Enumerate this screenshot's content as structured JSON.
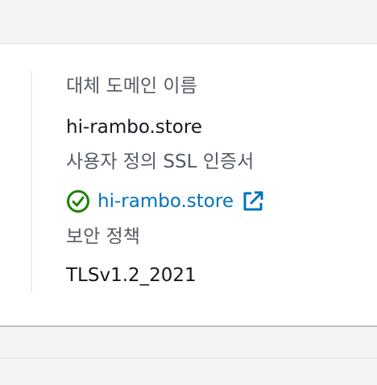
{
  "details": {
    "alt_domain_label": "대체 도메인 이름",
    "alt_domain_value": "hi-rambo.store",
    "ssl_label": "사용자 정의 SSL 인증서",
    "ssl_cert_link": "hi-rambo.store",
    "ssl_status_icon": "check-circle-icon",
    "ssl_external_icon": "external-link-icon",
    "policy_label": "보안 정책",
    "policy_value": "TLSv1.2_2021"
  },
  "colors": {
    "success": "#1d8102",
    "link": "#0073bb",
    "label": "#545b64",
    "value": "#16191f"
  }
}
